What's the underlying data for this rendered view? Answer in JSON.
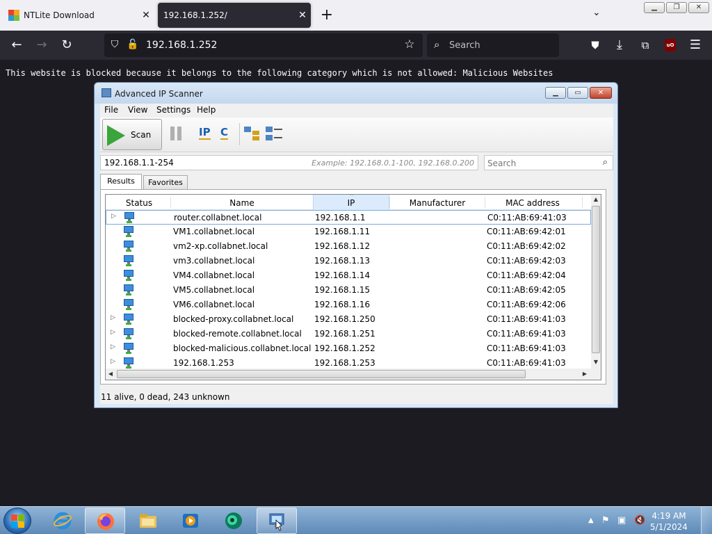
{
  "browser": {
    "tabs": [
      {
        "title": "NTLite Download",
        "close": "✕"
      },
      {
        "title": "192.168.1.252/",
        "close": "✕"
      }
    ],
    "new_tab": "+",
    "tab_list": "⌄",
    "url": "192.168.1.252",
    "search_placeholder": "Search",
    "ublock_label": "uO"
  },
  "page": {
    "blocked_message": "This website is blocked because it belongs to the following category which is not allowed: Malicious Websites"
  },
  "ip_scanner": {
    "title": "Advanced IP Scanner",
    "menu": [
      "File",
      "View",
      "Settings",
      "Help"
    ],
    "scan_label": "Scan",
    "ip_label": "IP",
    "c_label": "C",
    "range_value": "192.168.1.1-254",
    "range_example": "Example: 192.168.0.1-100, 192.168.0.200",
    "search_placeholder": "Search",
    "tabs": [
      "Results",
      "Favorites"
    ],
    "columns": [
      "Status",
      "Name",
      "IP",
      "Manufacturer",
      "MAC address"
    ],
    "rows": [
      {
        "expandable": true,
        "name": "router.collabnet.local",
        "ip": "192.168.1.1",
        "manufacturer": "",
        "mac": "C0:11:AB:69:41:03"
      },
      {
        "expandable": false,
        "name": "VM1.collabnet.local",
        "ip": "192.168.1.11",
        "manufacturer": "",
        "mac": "C0:11:AB:69:42:01"
      },
      {
        "expandable": false,
        "name": "vm2-xp.collabnet.local",
        "ip": "192.168.1.12",
        "manufacturer": "",
        "mac": "C0:11:AB:69:42:02"
      },
      {
        "expandable": false,
        "name": "vm3.collabnet.local",
        "ip": "192.168.1.13",
        "manufacturer": "",
        "mac": "C0:11:AB:69:42:03"
      },
      {
        "expandable": false,
        "name": "VM4.collabnet.local",
        "ip": "192.168.1.14",
        "manufacturer": "",
        "mac": "C0:11:AB:69:42:04"
      },
      {
        "expandable": false,
        "name": "VM5.collabnet.local",
        "ip": "192.168.1.15",
        "manufacturer": "",
        "mac": "C0:11:AB:69:42:05"
      },
      {
        "expandable": false,
        "name": "VM6.collabnet.local",
        "ip": "192.168.1.16",
        "manufacturer": "",
        "mac": "C0:11:AB:69:42:06"
      },
      {
        "expandable": true,
        "name": "blocked-proxy.collabnet.local",
        "ip": "192.168.1.250",
        "manufacturer": "",
        "mac": "C0:11:AB:69:41:03"
      },
      {
        "expandable": true,
        "name": "blocked-remote.collabnet.local",
        "ip": "192.168.1.251",
        "manufacturer": "",
        "mac": "C0:11:AB:69:41:03"
      },
      {
        "expandable": true,
        "name": "blocked-malicious.collabnet.local",
        "ip": "192.168.1.252",
        "manufacturer": "",
        "mac": "C0:11:AB:69:41:03"
      },
      {
        "expandable": true,
        "name": "192.168.1.253",
        "ip": "192.168.1.253",
        "manufacturer": "",
        "mac": "C0:11:AB:69:41:03"
      }
    ],
    "status": "11 alive, 0 dead, 243 unknown"
  },
  "taskbar": {
    "apps": [
      "internet-explorer-icon",
      "firefox-icon",
      "file-explorer-icon",
      "media-player-icon",
      "green-app-icon",
      "advanced-ip-scanner-icon"
    ],
    "time": "4:19 AM",
    "date": "5/1/2024"
  }
}
